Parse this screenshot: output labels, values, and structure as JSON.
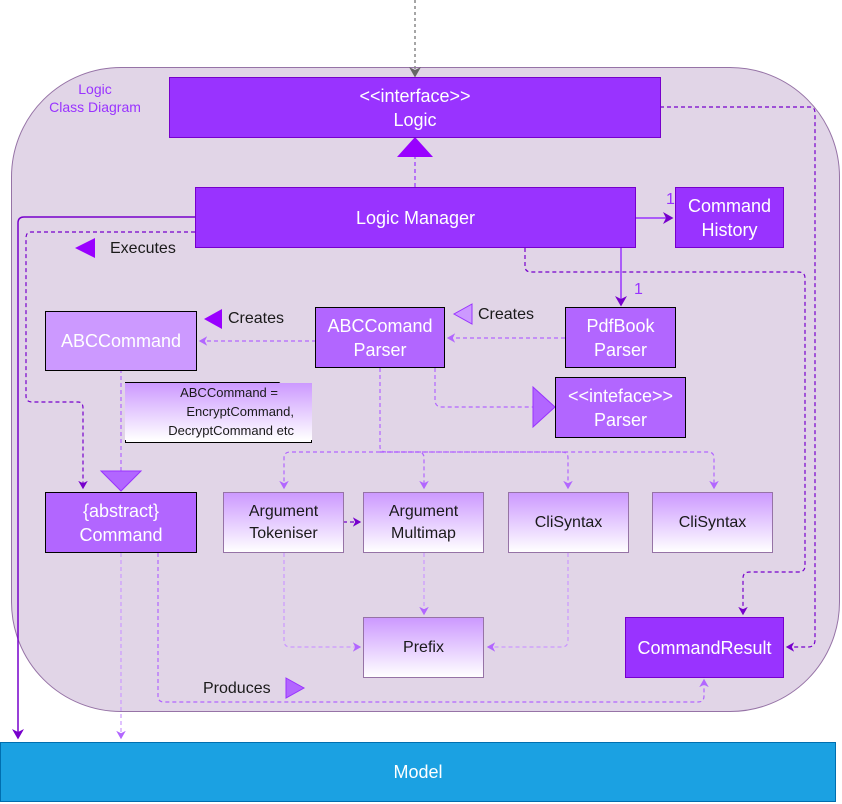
{
  "diagram": {
    "container_title": [
      "Logic",
      "Class Diagram"
    ],
    "nodes": {
      "logic_interface": {
        "stereotype": "<<interface>>",
        "name": "Logic"
      },
      "logic_manager": {
        "name": "Logic Manager"
      },
      "command_history": {
        "line1": "Command",
        "line2": "History"
      },
      "abc_command": {
        "name": "ABCCommand"
      },
      "abc_command_parser": {
        "line1": "ABCComand",
        "line2": "Parser"
      },
      "pdfbook_parser": {
        "line1": "PdfBook",
        "line2": "Parser"
      },
      "parser_interface": {
        "stereotype": "<<inteface>>",
        "name": "Parser"
      },
      "abstract_command": {
        "stereotype": "{abstract}",
        "name": "Command"
      },
      "argument_tokeniser": {
        "line1": "Argument",
        "line2": "Tokeniser"
      },
      "argument_multimap": {
        "line1": "Argument",
        "line2": "Multimap"
      },
      "cli_syntax_1": {
        "name": "CliSyntax"
      },
      "cli_syntax_2": {
        "name": "CliSyntax"
      },
      "prefix": {
        "name": "Prefix"
      },
      "command_result": {
        "name": "CommandResult"
      },
      "model": {
        "name": "Model"
      }
    },
    "note": {
      "line1": "ABCCommand =",
      "line2": "EncryptCommand,",
      "line3": "DecryptCommand etc"
    },
    "edge_labels": {
      "executes": "Executes",
      "creates_1": "Creates",
      "creates_2": "Creates",
      "produces": "Produces",
      "mult_history": "1",
      "mult_parser": "1"
    },
    "colors": {
      "container_fill": "#e1d5e7",
      "container_stroke": "#9673a6",
      "primary_purple": "#9933ff",
      "mid_purple": "#b266ff",
      "light_purple": "#cc99ff",
      "model_blue": "#1ba1e2"
    }
  }
}
